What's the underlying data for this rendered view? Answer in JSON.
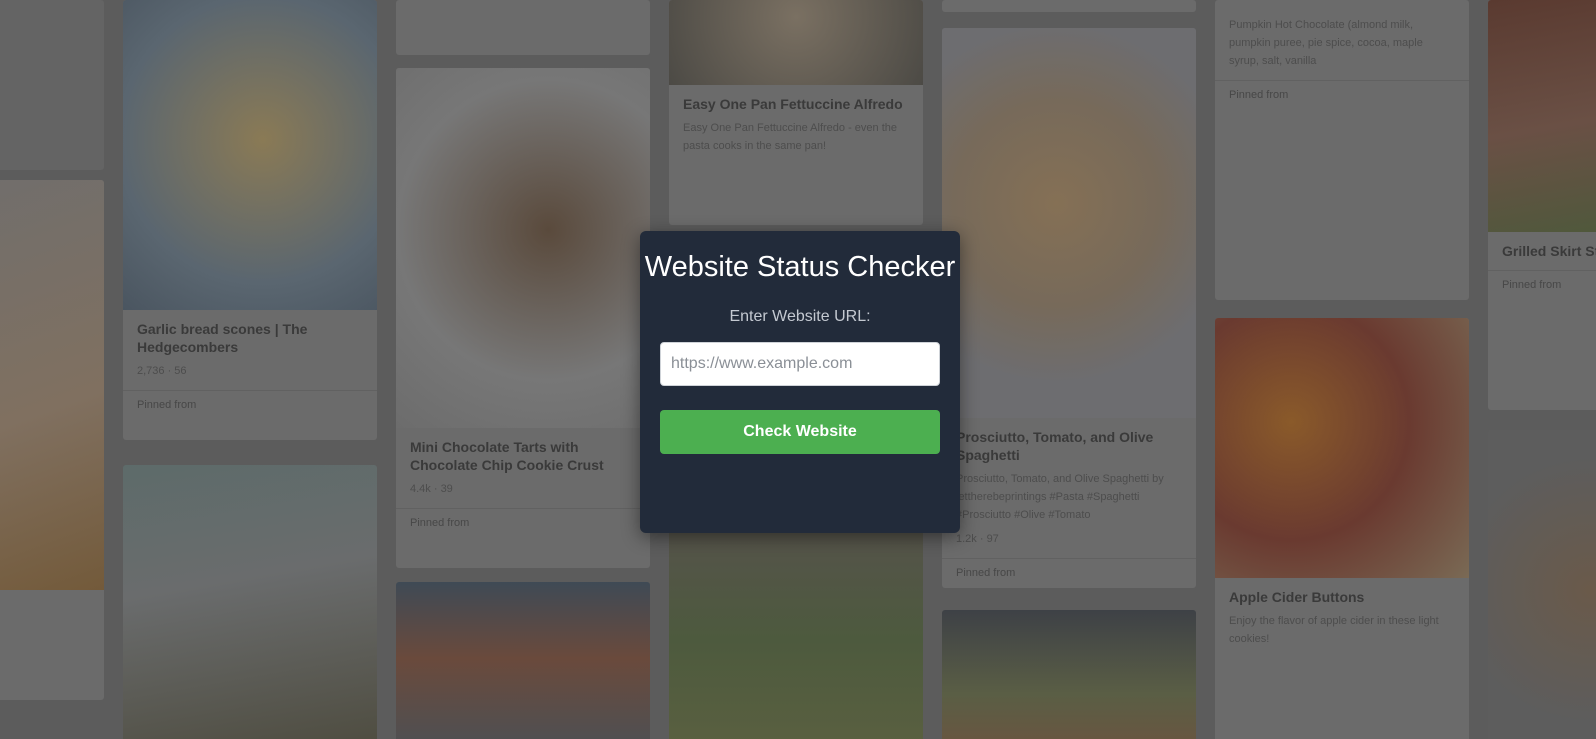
{
  "modal": {
    "title": "Website Status Checker",
    "url_label": "Enter Website URL:",
    "url_placeholder": "https://www.example.com",
    "url_value": "",
    "button_label": "Check Website"
  },
  "background": {
    "colors": {
      "page": "#5c5c5c",
      "card": "#6b6b6b",
      "modal": "#222b3a",
      "accent": "#4caf50"
    },
    "pins": [
      {
        "title": "Garlic bread scones | The Hedgecombers",
        "meta": "2,736 · 56",
        "pinned_from": "Pinned from"
      },
      {
        "title": "Mini Chocolate Tarts with Chocolate Chip Cookie Crust",
        "meta": "4.4k · 39",
        "pinned_from": "Pinned from"
      },
      {
        "title": "Easy One Pan Fettuccine Alfredo",
        "desc": "Easy One Pan Fettuccine Alfredo - even the pasta cooks in the same pan!"
      },
      {
        "title": "Prosciutto, Tomato, and Olive Spaghetti",
        "desc": "Prosciutto, Tomato, and Olive Spaghetti by lettherebeprintings #Pasta #Spaghetti #Prosciutto #Olive #Tomato",
        "meta": "1.2k · 97",
        "pinned_from": "Pinned from"
      },
      {
        "title": "Pumpkin Hot Chocolate",
        "desc": "Pumpkin Hot Chocolate (almond milk, pumpkin puree, pie spice, cocoa, maple syrup, salt, vanilla",
        "pinned_from": "Pinned from"
      },
      {
        "title": "Apple Cider Buttons",
        "desc": "Enjoy the flavor of apple cider in these light cookies!"
      },
      {
        "title": "Grilled Skirt Steak with Sriracha",
        "pinned_from": "Pinned from"
      }
    ]
  }
}
